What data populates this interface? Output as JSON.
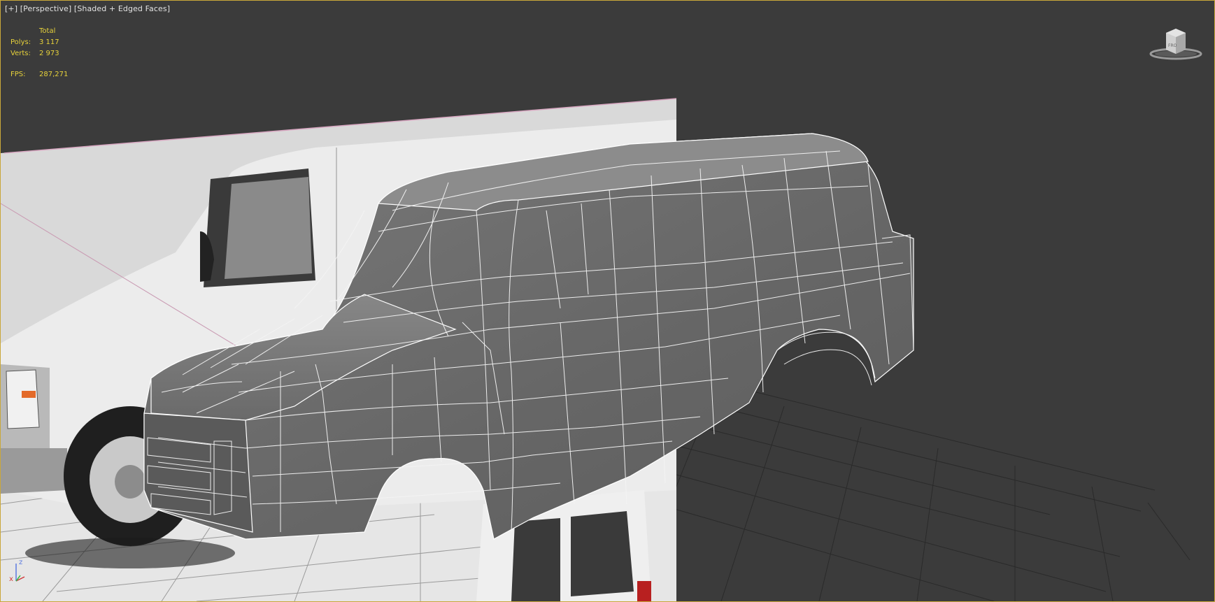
{
  "viewport": {
    "labels": [
      "[+]",
      "[Perspective]",
      "[Shaded + Edged Faces]"
    ]
  },
  "stats": {
    "header": "Total",
    "polys_label": "Polys:",
    "polys_value": "3 117",
    "verts_label": "Verts:",
    "verts_value": "2 973",
    "fps_label": "FPS:",
    "fps_value": "287,271"
  },
  "axis_gizmo": {
    "x": "x",
    "z": "z"
  },
  "colors": {
    "viewport_border": "#c9a73a",
    "background": "#3b3b3b",
    "stats_text": "#e7d23b",
    "wireframe": "#ffffff",
    "mesh_shade": "#6e6e6e"
  },
  "icons": {
    "viewcube": "viewcube-icon",
    "axis": "axis-tripod-icon"
  }
}
